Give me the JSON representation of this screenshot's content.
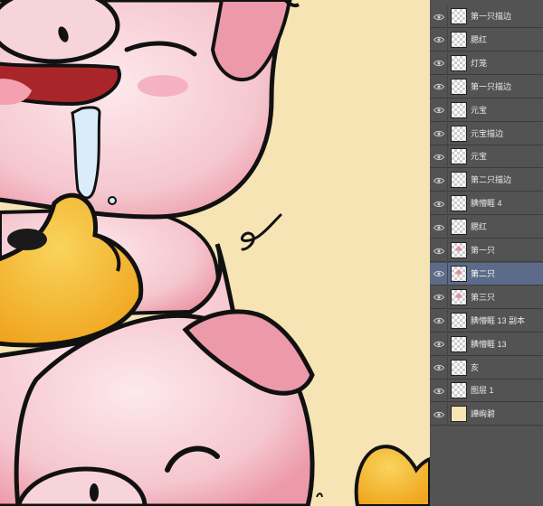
{
  "canvas": {
    "background": "#f6e4b5",
    "colors": {
      "pig_pink": "#f5c7cf",
      "pig_dark_pink": "#ec9aa9",
      "outline": "#111111",
      "gold": "#f0a51e",
      "gold_light": "#f9d45c",
      "mouth_red": "#a8262a"
    }
  },
  "layers_panel": {
    "background": "#535353",
    "selected_color": "#5c6b8a",
    "layers": [
      {
        "name": "第一只描边",
        "visible": true,
        "selected": false,
        "thumb": "transparent"
      },
      {
        "name": "腮红",
        "visible": true,
        "selected": false,
        "thumb": "transparent"
      },
      {
        "name": "灯笼",
        "visible": true,
        "selected": false,
        "thumb": "transparent"
      },
      {
        "name": "第一只描边",
        "visible": true,
        "selected": false,
        "thumb": "transparent"
      },
      {
        "name": "元宝",
        "visible": true,
        "selected": false,
        "thumb": "transparent"
      },
      {
        "name": "元宝描边",
        "visible": true,
        "selected": false,
        "thumb": "transparent"
      },
      {
        "name": "元宝",
        "visible": true,
        "selected": false,
        "thumb": "transparent"
      },
      {
        "name": "第二只描边",
        "visible": true,
        "selected": false,
        "thumb": "transparent"
      },
      {
        "name": "腆懵睚 4",
        "visible": true,
        "selected": false,
        "thumb": "transparent"
      },
      {
        "name": "腮红",
        "visible": true,
        "selected": false,
        "thumb": "transparent"
      },
      {
        "name": "第一只",
        "visible": true,
        "selected": false,
        "thumb": "pig"
      },
      {
        "name": "第二只",
        "visible": true,
        "selected": true,
        "thumb": "pig"
      },
      {
        "name": "第三只",
        "visible": true,
        "selected": false,
        "thumb": "pig"
      },
      {
        "name": "腆懵睚 13 副本",
        "visible": true,
        "selected": false,
        "thumb": "transparent"
      },
      {
        "name": "腆懵睚 13",
        "visible": true,
        "selected": false,
        "thumb": "transparent"
      },
      {
        "name": "亥",
        "visible": true,
        "selected": false,
        "thumb": "transparent"
      },
      {
        "name": "图层 1",
        "visible": true,
        "selected": false,
        "thumb": "transparent"
      },
      {
        "name": "譁峋碧",
        "visible": true,
        "selected": false,
        "thumb": "cream"
      }
    ]
  }
}
